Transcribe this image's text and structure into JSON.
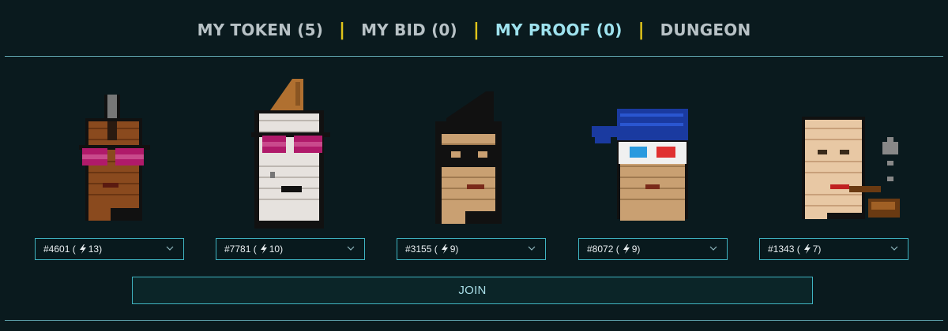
{
  "tabs": [
    {
      "label": "MY TOKEN (5)",
      "active": false
    },
    {
      "label": "MY BID (0)",
      "active": false
    },
    {
      "label": "MY PROOF (0)",
      "active": true
    },
    {
      "label": "DUNGEON",
      "active": false
    }
  ],
  "separator": "|",
  "colors": {
    "background": "#0a1a1e",
    "accent": "#3fb3c1",
    "active_tab": "#9ee2ee",
    "separator": "#e0c41a"
  },
  "tokens": [
    {
      "id_text": "#4601 (",
      "power": "13",
      "close": ")",
      "image": "punk-brown-mohawk-purple-shades"
    },
    {
      "id_text": "#7781 (",
      "power": "10",
      "close": ")",
      "image": "punk-white-cone-purple-shades"
    },
    {
      "id_text": "#3155 (",
      "power": "9",
      "close": ")",
      "image": "punk-tan-black-hair-mask"
    },
    {
      "id_text": "#8072 (",
      "power": "9",
      "close": ")",
      "image": "punk-tan-bandana-3d-glasses"
    },
    {
      "id_text": "#1343 (",
      "power": "7",
      "close": ")",
      "image": "punk-light-pipe"
    }
  ],
  "join_label": "JOIN"
}
